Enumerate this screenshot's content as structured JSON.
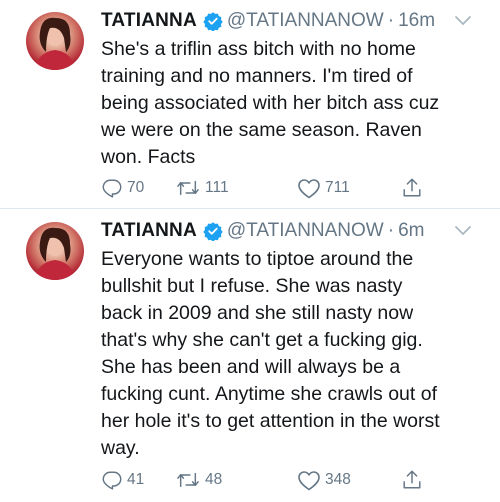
{
  "tweets": [
    {
      "name": "TATIANNA",
      "handle": "@TATIANNANOW",
      "separator": "·",
      "time": "16m",
      "text_lines": [
        "She's a triflin ass bitch with no home",
        "training and no manners. I'm tired of",
        "being associated with her bitch ass cuz",
        "we were on the same season. Raven",
        "won. Facts"
      ],
      "replies": "70",
      "retweets": "111",
      "likes": "711"
    },
    {
      "name": "TATIANNA",
      "handle": "@TATIANNANOW",
      "separator": "·",
      "time": "6m",
      "text_lines": [
        "Everyone wants to tiptoe around the",
        "bullshit but I refuse. She was nasty",
        "back in 2009 and she still nasty now",
        "that's why she can't get a fucking gig.",
        "She has been and will always be a",
        "fucking cunt.  Anytime she crawls out of",
        "her hole it's to get attention in the worst",
        "way."
      ],
      "replies": "41",
      "retweets": "48",
      "likes": "348"
    }
  ],
  "colors": {
    "text": "#14171a",
    "muted": "#657786",
    "verified": "#1da1f2",
    "divider": "#e1e8ed"
  },
  "icons": {
    "reply": "reply-icon",
    "retweet": "retweet-icon",
    "like": "heart-icon",
    "share": "share-icon",
    "verified": "verified-badge-icon",
    "menu": "chevron-down-icon"
  }
}
